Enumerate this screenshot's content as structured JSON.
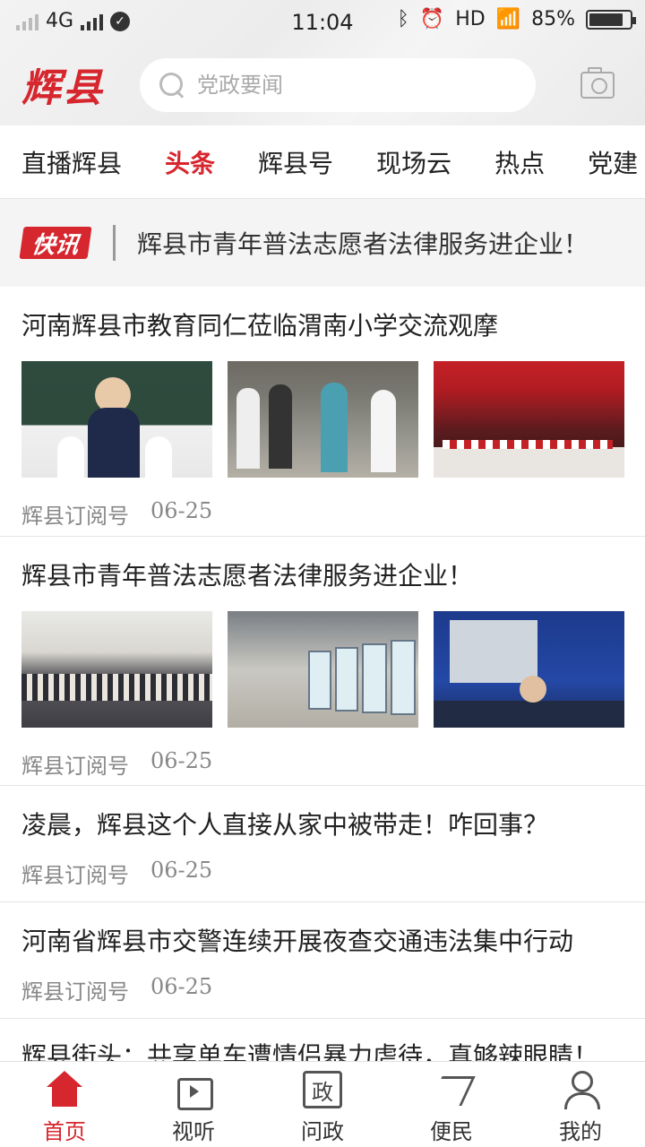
{
  "status_bar": {
    "network": "4G",
    "time": "11:04",
    "hd": "HD",
    "battery": "85%",
    "battery_level": 0.85
  },
  "header": {
    "logo": "辉县",
    "search_placeholder": "党政要闻"
  },
  "tabs": [
    {
      "label": "直播辉县",
      "active": false
    },
    {
      "label": "头条",
      "active": true
    },
    {
      "label": "辉县号",
      "active": false
    },
    {
      "label": "现场云",
      "active": false
    },
    {
      "label": "热点",
      "active": false
    },
    {
      "label": "党建",
      "active": false
    }
  ],
  "flash": {
    "badge": "快讯",
    "text": "辉县市青年普法志愿者法律服务进企业！"
  },
  "news": [
    {
      "title": "河南辉县市教育同仁莅临渭南小学交流观摩",
      "source": "辉县订阅号",
      "date": "06-25"
    },
    {
      "title": "辉县市青年普法志愿者法律服务进企业！",
      "source": "辉县订阅号",
      "date": "06-25"
    },
    {
      "title": "凌晨，辉县这个人直接从家中被带走！咋回事？",
      "source": "辉县订阅号",
      "date": "06-25"
    },
    {
      "title": "河南省辉县市交警连续开展夜查交通违法集中行动",
      "source": "辉县订阅号",
      "date": "06-25"
    },
    {
      "title": "辉县街头：共享单车遭情侣暴力虐待，真够辣眼睛！"
    }
  ],
  "bottom_nav": [
    {
      "label": "首页",
      "icon": "home-icon",
      "active": true
    },
    {
      "label": "视听",
      "icon": "tv-icon",
      "active": false
    },
    {
      "label": "问政",
      "icon": "zheng-icon",
      "glyph": "政",
      "active": false
    },
    {
      "label": "便民",
      "icon": "send-icon",
      "active": false
    },
    {
      "label": "我的",
      "icon": "user-icon",
      "active": false
    }
  ]
}
